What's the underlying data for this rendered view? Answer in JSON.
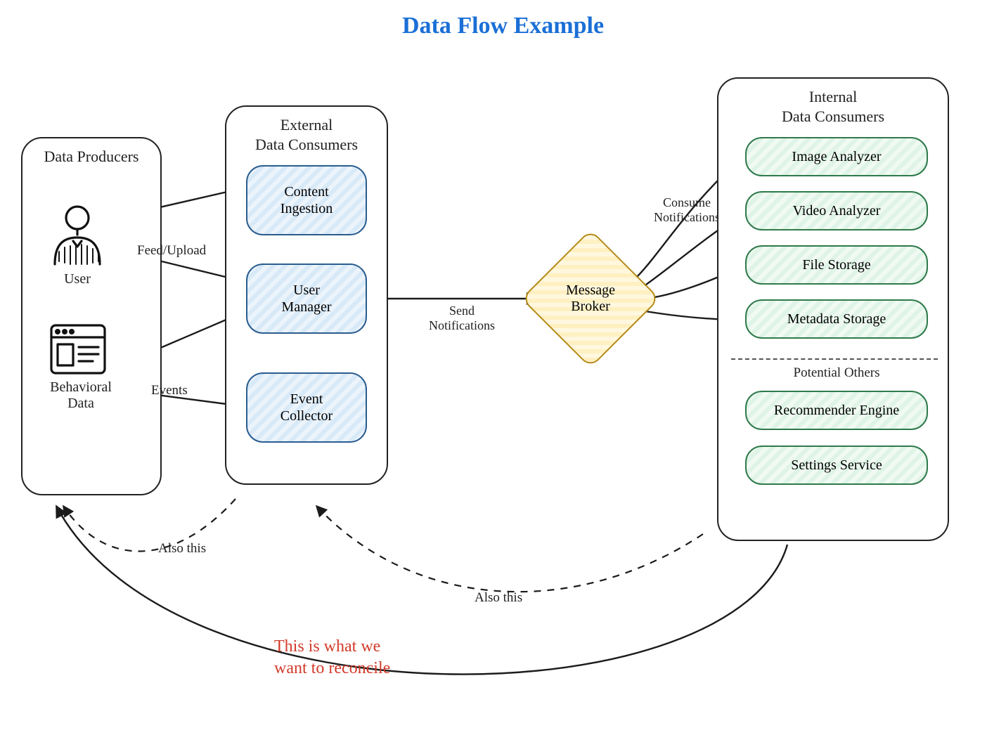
{
  "title": "Data Flow Example",
  "panels": {
    "producers": {
      "title": "Data Producers"
    },
    "external": {
      "title": "External\nData Consumers"
    },
    "internal": {
      "title": "Internal\nData Consumers"
    }
  },
  "producers": {
    "user_caption": "User",
    "behavioral_caption": "Behavioral\nData"
  },
  "external_nodes": {
    "ingestion": "Content\nIngestion",
    "user_mgr": "User\nManager",
    "event_col": "Event\nCollector"
  },
  "internal_nodes": {
    "image": "Image Analyzer",
    "video": "Video Analyzer",
    "file": "File Storage",
    "meta": "Metadata Storage",
    "others_title": "Potential Others",
    "reco": "Recommender Engine",
    "settings": "Settings Service"
  },
  "broker": "Message\nBroker",
  "edge_labels": {
    "feed_upload": "Feed/Upload",
    "events": "Events",
    "send_notifications": "Send\nNotifications",
    "consume_notifications": "Consume\nNotifications",
    "also_this_left": "Also this",
    "also_this_mid": "Also this",
    "reconcile": "This is what we\nwant to reconcile"
  }
}
